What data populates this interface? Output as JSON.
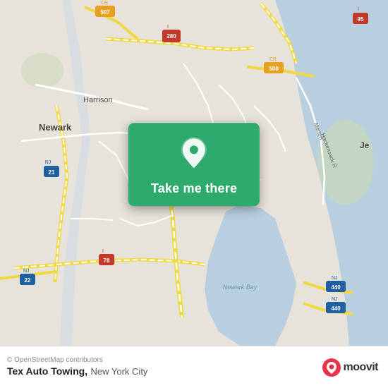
{
  "map": {
    "alt": "Map of Newark and Jersey City area, New York City"
  },
  "button": {
    "label": "Take me there"
  },
  "bottom_bar": {
    "osm_credit": "© OpenStreetMap contributors",
    "location_name": "Tex Auto Towing,",
    "location_city": "New York City"
  },
  "moovit": {
    "text": "moovit"
  },
  "colors": {
    "green": "#2eaa6e",
    "road_yellow": "#f5e56b",
    "road_white": "#ffffff",
    "water": "#b8d4e8",
    "land": "#ece8e0"
  }
}
